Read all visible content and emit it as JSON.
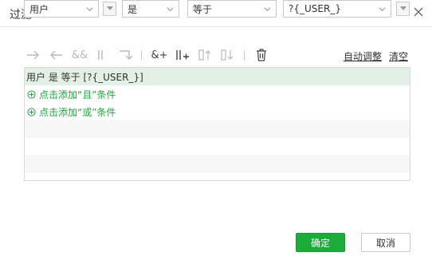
{
  "dialog": {
    "title": "过滤"
  },
  "toolbar": {
    "icons": [
      {
        "name": "arrow-right-icon",
        "glyph": "→",
        "enabled": false
      },
      {
        "name": "arrow-left-icon",
        "glyph": "←",
        "enabled": false
      },
      {
        "name": "and-icon",
        "glyph": "&&",
        "enabled": false
      },
      {
        "name": "or-icon",
        "glyph": "||",
        "enabled": false
      },
      {
        "name": "return-icon",
        "glyph": "⮌",
        "enabled": false
      },
      {
        "name": "add-and-icon",
        "glyph": "&+",
        "enabled": true
      },
      {
        "name": "add-or-icon",
        "glyph": "||+",
        "enabled": true
      },
      {
        "name": "move-up-icon",
        "glyph": "⇡",
        "enabled": false
      },
      {
        "name": "move-down-icon",
        "glyph": "⇣",
        "enabled": false
      },
      {
        "name": "delete-icon",
        "glyph": "🗑",
        "enabled": true
      }
    ],
    "auto_adjust_label": "自动调整",
    "clear_label": "清空"
  },
  "conditions": {
    "selected_row": "用户 是 等于 [?{_USER_}]",
    "add_and_label": "点击添加“且”条件",
    "add_or_label": "点击添加“或”条件"
  },
  "editor": {
    "field_value": "用户",
    "operator1_value": "是",
    "operator2_value": "等于",
    "value_value": "?{_USER_}"
  },
  "buttons": {
    "ok_label": "确定",
    "cancel_label": "取消"
  },
  "colors": {
    "accent": "#1aad3a",
    "selected_row": "#e3f0e4"
  }
}
